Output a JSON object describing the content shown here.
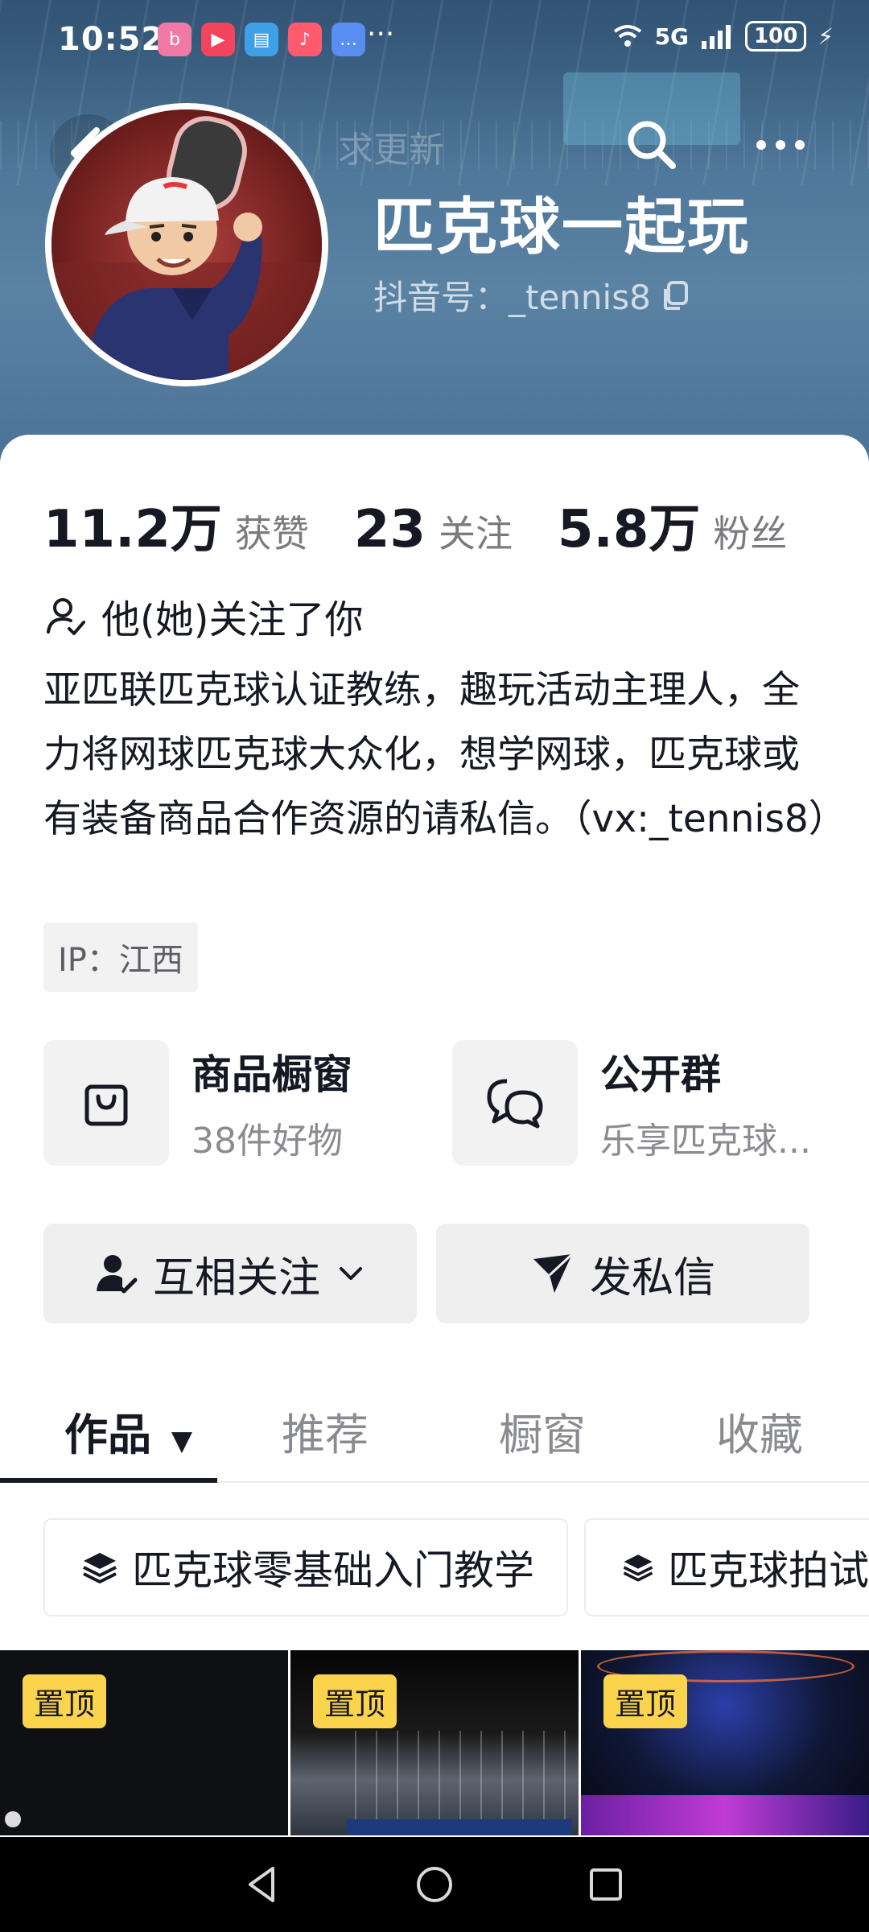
{
  "status_bar": {
    "time": "10:52",
    "network": "5G",
    "battery": "100"
  },
  "banner": {
    "watermark": "求更新"
  },
  "profile": {
    "nickname": "匹克球一起玩",
    "douyin_id": "抖音号：_tennis8"
  },
  "stats": [
    {
      "value": "11.2万",
      "label": "获赞"
    },
    {
      "value": "23",
      "label": "关注"
    },
    {
      "value": "5.8万",
      "label": "粉丝"
    }
  ],
  "follow_status": "他(她)关注了你",
  "bio": "亚匹联匹克球认证教练，趣玩活动主理人，全力将网球匹克球大众化，想学网球，匹克球或有装备商品合作资源的请私信。（vx:_tennis8）",
  "ip": "IP：江西",
  "features": {
    "shop": {
      "title": "商品橱窗",
      "subtitle": "38件好物"
    },
    "group": {
      "title": "公开群",
      "subtitle": "乐享匹克球..."
    }
  },
  "actions": {
    "mutual_follow": "互相关注",
    "message": "发私信"
  },
  "tabs": [
    "作品",
    "推荐",
    "橱窗",
    "收藏"
  ],
  "collections": [
    "匹克球零基础入门教学",
    "匹克球拍试"
  ],
  "videos": [
    {
      "pin_label": "置顶"
    },
    {
      "pin_label": "置顶"
    },
    {
      "pin_label": "置顶"
    }
  ],
  "colors": {
    "banner": "#4d7597",
    "pin": "#fcd34d",
    "text": "#161823",
    "muted": "#8a8b91"
  }
}
